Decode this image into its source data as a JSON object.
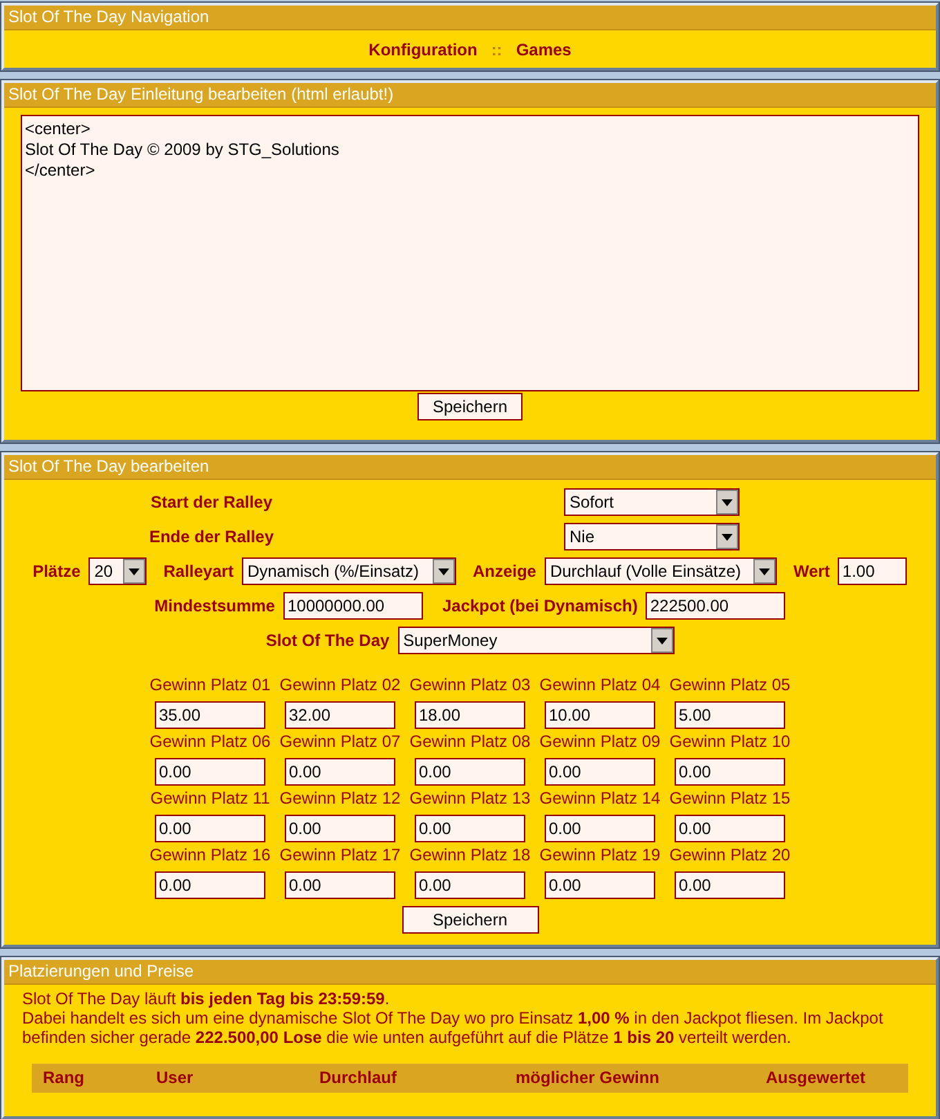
{
  "navigation": {
    "title": "Slot Of The Day Navigation",
    "links": [
      "Konfiguration",
      "Games"
    ],
    "separator": "::"
  },
  "intro": {
    "title": "Slot Of The Day Einleitung bearbeiten (html erlaubt!)",
    "text": "<center>\nSlot Of The Day © 2009 by STG_Solutions\n</center>",
    "button": "Speichern"
  },
  "edit": {
    "title": "Slot Of The Day bearbeiten",
    "start": {
      "label": "Start der Ralley",
      "value": "Sofort"
    },
    "end": {
      "label": "Ende der Ralley",
      "value": "Nie"
    },
    "row": [
      {
        "kind": "select",
        "label": "Plätze",
        "value": "20"
      },
      {
        "kind": "select",
        "label": "Ralleyart",
        "value": "Dynamisch (%/Einsatz)"
      },
      {
        "kind": "select",
        "label": "Anzeige",
        "value": "Durchlauf (Volle Einsätze)"
      },
      {
        "kind": "input",
        "label": "Wert",
        "value": "1.00"
      }
    ],
    "sums": [
      {
        "label": "Mindestsumme",
        "value": "10000000.00"
      },
      {
        "label": "Jackpot (bei Dynamisch)",
        "value": "222500.00"
      }
    ],
    "slot": {
      "label": "Slot Of The Day",
      "value": "SuperMoney"
    },
    "prizes": [
      {
        "label": "Gewinn Platz 01",
        "value": "35.00"
      },
      {
        "label": "Gewinn Platz 02",
        "value": "32.00"
      },
      {
        "label": "Gewinn Platz 03",
        "value": "18.00"
      },
      {
        "label": "Gewinn Platz 04",
        "value": "10.00"
      },
      {
        "label": "Gewinn Platz 05",
        "value": "5.00"
      },
      {
        "label": "Gewinn Platz 06",
        "value": "0.00"
      },
      {
        "label": "Gewinn Platz 07",
        "value": "0.00"
      },
      {
        "label": "Gewinn Platz 08",
        "value": "0.00"
      },
      {
        "label": "Gewinn Platz 09",
        "value": "0.00"
      },
      {
        "label": "Gewinn Platz 10",
        "value": "0.00"
      },
      {
        "label": "Gewinn Platz 11",
        "value": "0.00"
      },
      {
        "label": "Gewinn Platz 12",
        "value": "0.00"
      },
      {
        "label": "Gewinn Platz 13",
        "value": "0.00"
      },
      {
        "label": "Gewinn Platz 14",
        "value": "0.00"
      },
      {
        "label": "Gewinn Platz 15",
        "value": "0.00"
      },
      {
        "label": "Gewinn Platz 16",
        "value": "0.00"
      },
      {
        "label": "Gewinn Platz 17",
        "value": "0.00"
      },
      {
        "label": "Gewinn Platz 18",
        "value": "0.00"
      },
      {
        "label": "Gewinn Platz 19",
        "value": "0.00"
      },
      {
        "label": "Gewinn Platz 20",
        "value": "0.00"
      }
    ],
    "button": "Speichern"
  },
  "ranking": {
    "title": "Platzierungen und Preise",
    "lines": [
      "Slot Of The Day läuft **bis jeden Tag bis 23:59:59**.",
      "Dabei handelt es sich um eine dynamische Slot Of The Day wo pro Einsatz **1,00 %** in den Jackpot fliesen. Im Jackpot befinden sicher gerade **222.500,00 Lose** die wie unten aufgeführt auf die Plätze **1 bis 20** verteilt werden."
    ],
    "table": {
      "columns": [
        "Rang",
        "User",
        "Durchlauf",
        "möglicher Gewinn",
        "Ausgewertet"
      ]
    }
  }
}
